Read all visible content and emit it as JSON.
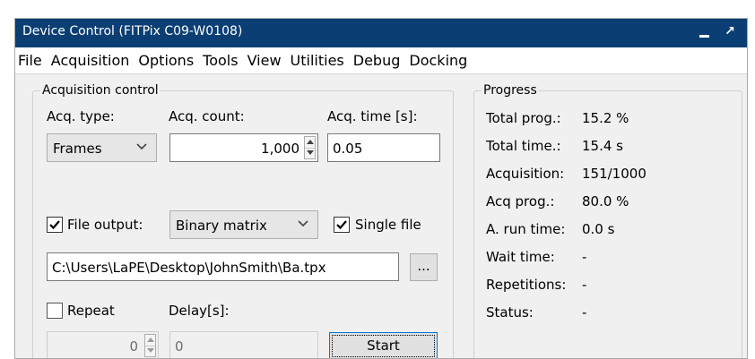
{
  "window": {
    "title": "Device Control (FITPix C09-W0108)"
  },
  "menu": [
    "File",
    "Acquisition",
    "Options",
    "Tools",
    "View",
    "Utilities",
    "Debug",
    "Docking"
  ],
  "acquisition_control": {
    "title": "Acquisition control",
    "acq_type_label": "Acq. type:",
    "acq_count_label": "Acq. count:",
    "acq_time_label": "Acq. time [s]:",
    "acq_type_value": "Frames",
    "acq_count_value": "1,000",
    "acq_time_value": "0.05",
    "file_output_label": "File output:",
    "file_output_checked": true,
    "file_format_value": "Binary matrix",
    "single_file_label": "Single file",
    "single_file_checked": true,
    "file_path_value": "C:\\Users\\LaPE\\Desktop\\JohnSmith\\Ba.tpx",
    "browse_label": "...",
    "repeat_label": "Repeat",
    "repeat_checked": false,
    "delay_label": "Delay[s]:",
    "repeat_count_value": "0",
    "delay_value": "0",
    "start_label": "Start"
  },
  "progress": {
    "title": "Progress",
    "rows": [
      {
        "label": "Total prog.:",
        "value": "15.2 %"
      },
      {
        "label": "Total time.:",
        "value": "15.4 s"
      },
      {
        "label": "Acquisition:",
        "value": "151/1000"
      },
      {
        "label": "Acq prog.:",
        "value": "80.0 %"
      },
      {
        "label": "A. run time:",
        "value": "0.0 s"
      },
      {
        "label": "Wait time:",
        "value": "-"
      },
      {
        "label": "Repetitions:",
        "value": "-"
      },
      {
        "label": "Status:",
        "value": "-"
      }
    ]
  },
  "colors": {
    "titlebar": "#0b3f74",
    "window_bg": "#f0f0f0",
    "focus": "#0078d7"
  }
}
